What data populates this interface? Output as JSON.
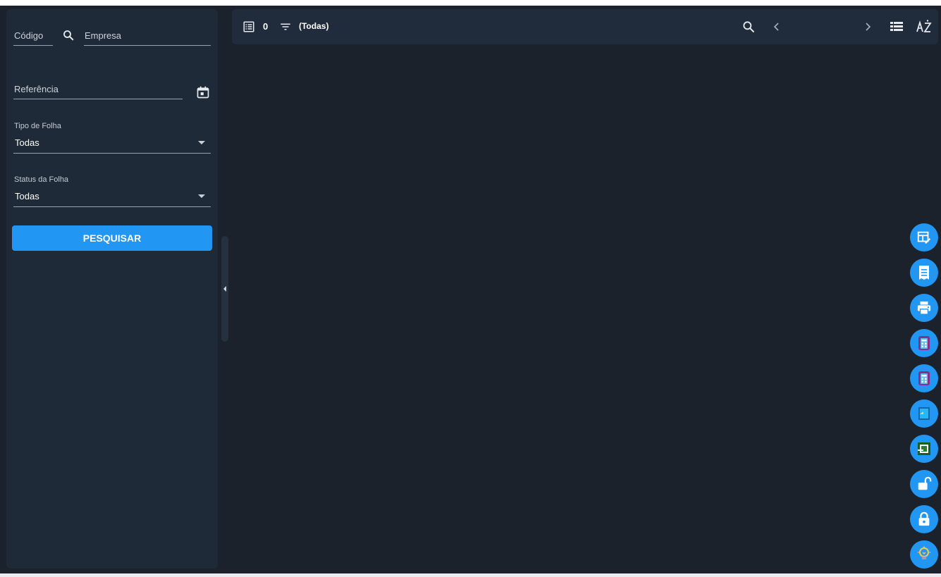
{
  "filters": {
    "codigo_label": "Código",
    "empresa_label": "Empresa",
    "referencia_label": "Referência",
    "tipo_folha": {
      "label": "Tipo de Folha",
      "value": "Todas"
    },
    "status_folha": {
      "label": "Status da Folha",
      "value": "Todas"
    },
    "search_button": "PESQUISAR"
  },
  "toolbar": {
    "record_count": "0",
    "filter_text": "(Todas)"
  },
  "fab_icons": [
    "edit-table-icon",
    "receipt-icon",
    "print-icon",
    "calculator-icon",
    "calculator-icon",
    "document-icon",
    "add-screen-icon",
    "unlock-icon",
    "lock-icon",
    "lightbulb-icon"
  ],
  "colors": {
    "accent": "#2196f3",
    "background": "#1b222c",
    "panel": "#1f2a38"
  }
}
